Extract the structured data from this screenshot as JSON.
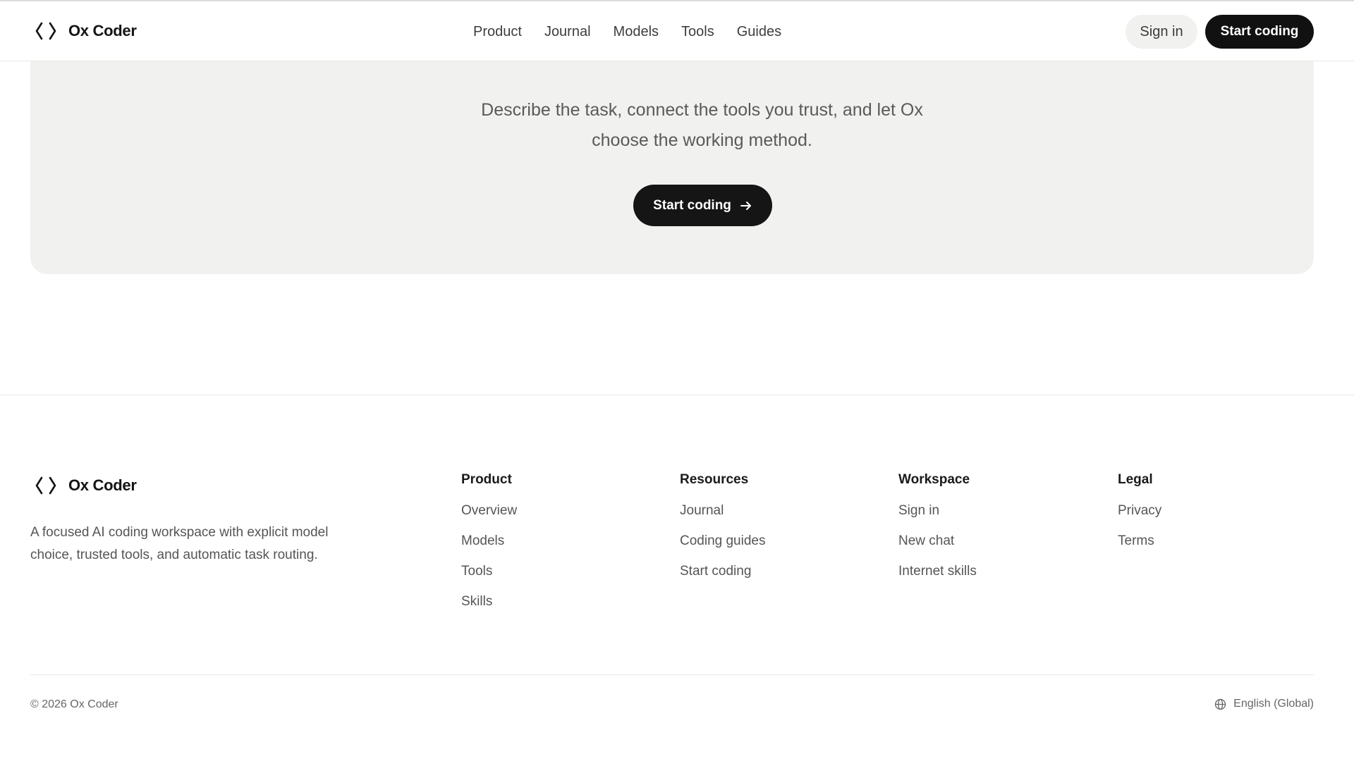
{
  "brand": {
    "name": "Ox Coder"
  },
  "nav": {
    "items": [
      "Product",
      "Journal",
      "Models",
      "Tools",
      "Guides"
    ]
  },
  "header": {
    "sign_in": "Sign in",
    "start_coding": "Start coding"
  },
  "hero": {
    "text_line1": "Describe the task, connect the tools you trust, and let Ox",
    "text_line2": "choose the working method.",
    "cta_label": "Start coding"
  },
  "footer": {
    "description_line1": "A focused AI coding workspace with explicit model",
    "description_line2": "choice, trusted tools, and automatic task routing.",
    "columns": [
      {
        "title": "Product",
        "links": [
          "Overview",
          "Models",
          "Tools",
          "Skills"
        ]
      },
      {
        "title": "Resources",
        "links": [
          "Journal",
          "Coding guides",
          "Start coding"
        ]
      },
      {
        "title": "Workspace",
        "links": [
          "Sign in",
          "New chat",
          "Internet skills"
        ]
      },
      {
        "title": "Legal",
        "links": [
          "Privacy",
          "Terms"
        ]
      }
    ],
    "copyright": "© 2026 Ox Coder",
    "language": "English (Global)"
  },
  "colors": {
    "accent_dark": "#111111",
    "panel_bg": "#f1f1ef"
  },
  "icons": [
    "code-brackets-icon",
    "arrow-right-icon",
    "globe-icon"
  ]
}
